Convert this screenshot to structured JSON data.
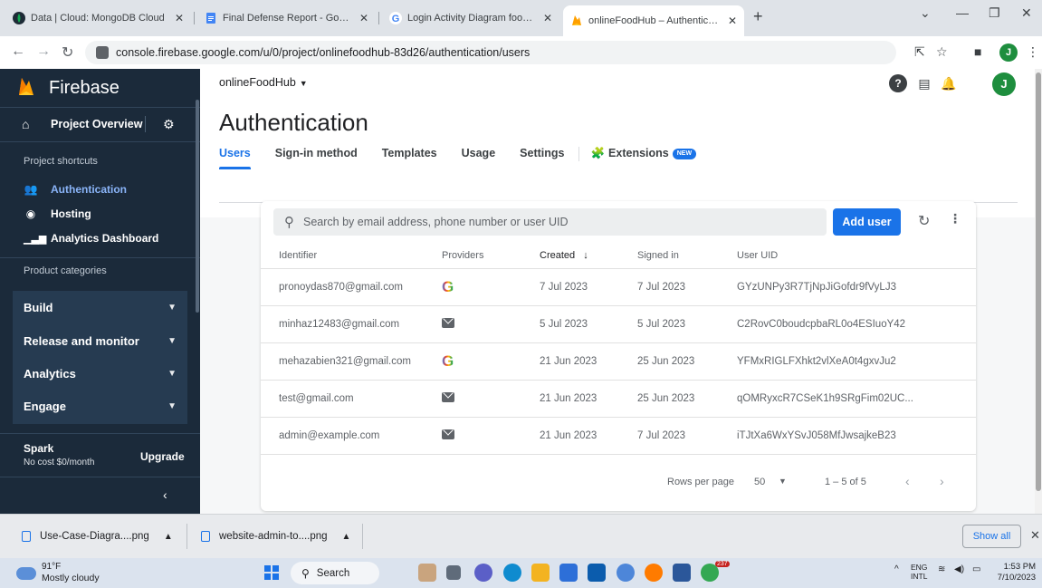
{
  "browser": {
    "tabs": [
      {
        "title": "Data | Cloud: MongoDB Cloud",
        "icon": "mongodb-icon",
        "color": "#00684a"
      },
      {
        "title": "Final Defense Report - Google Do",
        "icon": "google-docs-icon",
        "color": "#4285f4"
      },
      {
        "title": "Login Activity Diagram food web",
        "icon": "google-icon",
        "color": "#4285f4"
      },
      {
        "title": "onlineFoodHub – Authentication",
        "icon": "firebase-icon",
        "color": "#ffca28",
        "active": true
      }
    ],
    "url": "console.firebase.google.com/u/0/project/onlinefoodhub-83d26/authentication/users",
    "profile_initial": "J"
  },
  "sidebar": {
    "brand": "Firebase",
    "overview_label": "Project Overview",
    "shortcuts_heading": "Project shortcuts",
    "shortcuts": [
      {
        "label": "Authentication",
        "icon": "people-icon",
        "active": true
      },
      {
        "label": "Hosting",
        "icon": "globe-icon",
        "active": false
      },
      {
        "label": "Analytics Dashboard",
        "icon": "bar-chart-icon",
        "active": false
      }
    ],
    "categories_heading": "Product categories",
    "categories": [
      "Build",
      "Release and monitor",
      "Analytics",
      "Engage"
    ],
    "plan_name": "Spark",
    "plan_cost": "No cost $0/month",
    "upgrade_label": "Upgrade"
  },
  "topbar": {
    "project_name": "onlineFoodHub",
    "avatar_initial": "J"
  },
  "page": {
    "title": "Authentication",
    "tabs": [
      "Users",
      "Sign-in method",
      "Templates",
      "Usage",
      "Settings"
    ],
    "active_tab": "Users",
    "extensions_label": "Extensions",
    "new_badge": "NEW"
  },
  "users": {
    "search_placeholder": "Search by email address, phone number or user UID",
    "add_user_label": "Add user",
    "columns": [
      "Identifier",
      "Providers",
      "Created",
      "Signed in",
      "User UID"
    ],
    "sort_column": "Created",
    "rows": [
      {
        "identifier": "pronoydas870@gmail.com",
        "provider": "google",
        "created": "7 Jul 2023",
        "signed_in": "7 Jul 2023",
        "uid": "GYzUNPy3R7TjNpJiGofdr9fVyLJ3"
      },
      {
        "identifier": "minhaz12483@gmail.com",
        "provider": "email",
        "created": "5 Jul 2023",
        "signed_in": "5 Jul 2023",
        "uid": "C2RovC0boudcpbaRL0o4ESIuoY42"
      },
      {
        "identifier": "mehazabien321@gmail.com",
        "provider": "google",
        "created": "21 Jun 2023",
        "signed_in": "25 Jun 2023",
        "uid": "YFMxRIGLFXhkt2vlXeA0t4gxvJu2"
      },
      {
        "identifier": "test@gmail.com",
        "provider": "email",
        "created": "21 Jun 2023",
        "signed_in": "25 Jun 2023",
        "uid": "qOMRyxcR7CSeK1h9SRgFim02UC..."
      },
      {
        "identifier": "admin@example.com",
        "provider": "email",
        "created": "21 Jun 2023",
        "signed_in": "7 Jul 2023",
        "uid": "iTJtXa6WxYSvJ058MfJwsajkeB23"
      }
    ],
    "rows_per_page_label": "Rows per page",
    "rows_per_page": "50",
    "range": "1 – 5 of 5"
  },
  "downloads": {
    "items": [
      "Use-Case-Diagra....png",
      "website-admin-to....png"
    ],
    "show_all_label": "Show all"
  },
  "taskbar": {
    "temperature": "91°F",
    "weather": "Mostly cloudy",
    "search_label": "Search",
    "lang_line1": "ENG",
    "lang_line2": "INTL",
    "time": "1:53 PM",
    "date": "7/10/2023",
    "mail_badge": "237"
  },
  "colors": {
    "firebase_sidebar": "#1b2a3a",
    "accent_blue": "#1a73e8",
    "active_link": "#8ab4f8"
  }
}
